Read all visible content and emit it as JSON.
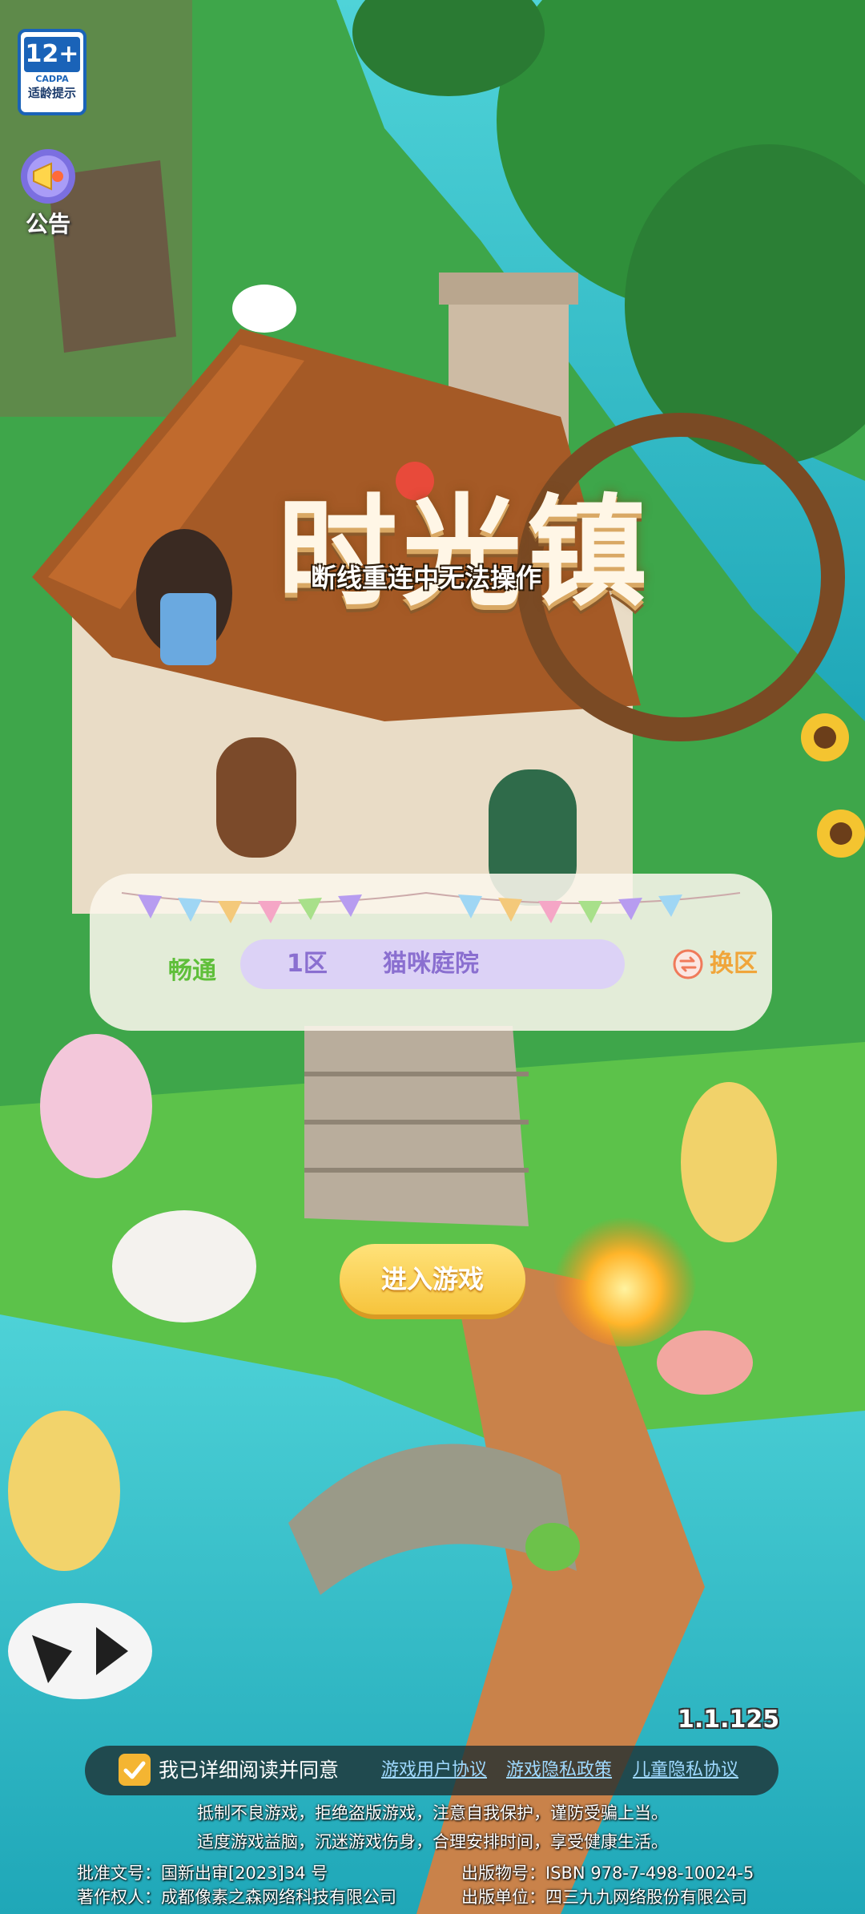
{
  "top_left": {
    "age_rating": "12+",
    "age_org": "CADPA",
    "age_tip": "适龄提示",
    "notice_label": "公告",
    "notice_icon": "megaphone-icon"
  },
  "logo": {
    "title": "时光镇",
    "status_overlay": "断线重连中无法操作"
  },
  "server": {
    "status": "畅通",
    "zone": "1区",
    "name": "猫咪庭院",
    "switch_label": "换区",
    "switch_icon": "swap-icon"
  },
  "enter_button": "进入游戏",
  "version": "1.1.125",
  "agreement": {
    "checked_icon": "checkmark-icon",
    "text": "我已详细阅读并同意",
    "links": [
      "游戏用户协议",
      "游戏隐私政策",
      "儿童隐私协议"
    ]
  },
  "health_notice": [
    "抵制不良游戏，拒绝盗版游戏，注意自我保护，谨防受骗上当。",
    "适度游戏益脑，沉迷游戏伤身，合理安排时间，享受健康生活。"
  ],
  "footer": {
    "approval": "批准文号：国新出审[2023]34  号",
    "publication": "出版物号：ISBN 978-7-498-10024-5",
    "copyright": "著作权人：成都像素之森网络科技有限公司",
    "publisher": "出版单位：四三九九网络股份有限公司"
  },
  "colors": {
    "server_status": "#5fbf3a",
    "server_text": "#8a6fd0",
    "switch_text": "#f0a53a",
    "enter_button": "#f6c43c",
    "link": "#9fd9ff"
  }
}
